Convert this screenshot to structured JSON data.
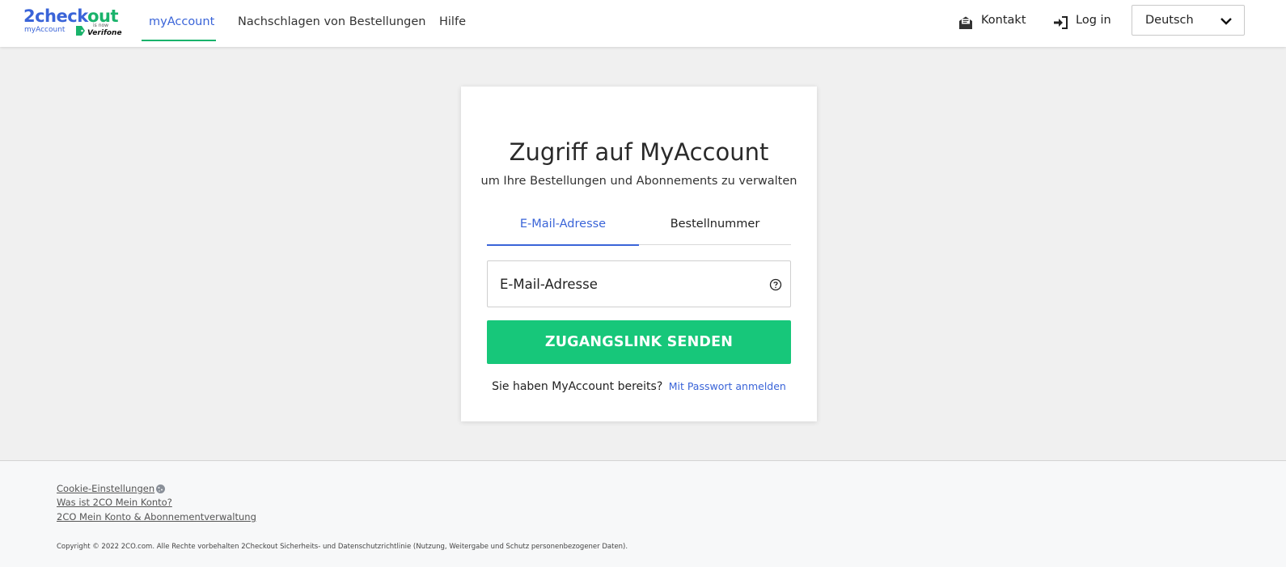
{
  "header": {
    "logo": {
      "word_part1": "2check",
      "word_part2": "out",
      "sub": "myAccount",
      "is_now": "is now",
      "verifone": "Verifone"
    },
    "nav": {
      "myaccount": "myAccount",
      "lookup": "Nachschlagen von Bestellungen",
      "help": "Hilfe"
    },
    "contact": {
      "label": "Kontakt",
      "icon": "envelope-icon"
    },
    "login": {
      "label": "Log in",
      "icon": "login-arrow-icon"
    },
    "language": {
      "selected": "Deutsch",
      "icon": "chevron-down-icon"
    }
  },
  "card": {
    "title": "Zugriff auf MyAccount",
    "subtitle": "um Ihre Bestellungen und Abonnements zu verwalten",
    "tabs": [
      {
        "label": "E-Mail-Adresse",
        "active": true
      },
      {
        "label": "Bestellnummer",
        "active": false
      }
    ],
    "email_field": {
      "placeholder": "E-Mail-Adresse",
      "value": "",
      "help_icon": "question-circle-icon"
    },
    "send_button": "ZUGANGSLINK SENDEN",
    "existing_text": "Sie haben MyAccount bereits?",
    "password_link": "Mit Passwort anmelden"
  },
  "footer": {
    "links": [
      "Cookie-Einstellungen",
      "Was ist 2CO Mein Konto?",
      "2CO Mein Konto & Abonnementverwaltung"
    ],
    "cookie_icon": "cookie-icon",
    "copyright": "Copyright © 2022 2CO.com. Alle Rechte vorbehalten 2Checkout Sicherheits- und Datenschutzrichtlinie (Nutzung, Weitergabe und Schutz personenbezogener Daten)."
  },
  "colors": {
    "accent_blue": "#3a64d8",
    "brand_green": "#17c77a",
    "background": "#f0f0f0"
  }
}
